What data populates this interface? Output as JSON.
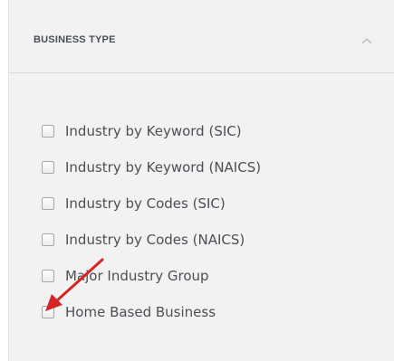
{
  "panel": {
    "title": "BUSINESS TYPE",
    "toggle_icon": "chevron-up-icon"
  },
  "options": [
    {
      "label": "Industry by Keyword (SIC)",
      "checked": false
    },
    {
      "label": "Industry by Keyword (NAICS)",
      "checked": false
    },
    {
      "label": "Industry by Codes (SIC)",
      "checked": false
    },
    {
      "label": "Industry by Codes (NAICS)",
      "checked": false
    },
    {
      "label": "Major Industry Group",
      "checked": false
    },
    {
      "label": "Home Based Business",
      "checked": false
    }
  ],
  "annotation": {
    "icon": "red-arrow-icon",
    "color": "#d62424"
  },
  "colors": {
    "panel_background": "#f2f2f2",
    "title_text": "#4a4f57",
    "option_text": "#4b4f55"
  }
}
